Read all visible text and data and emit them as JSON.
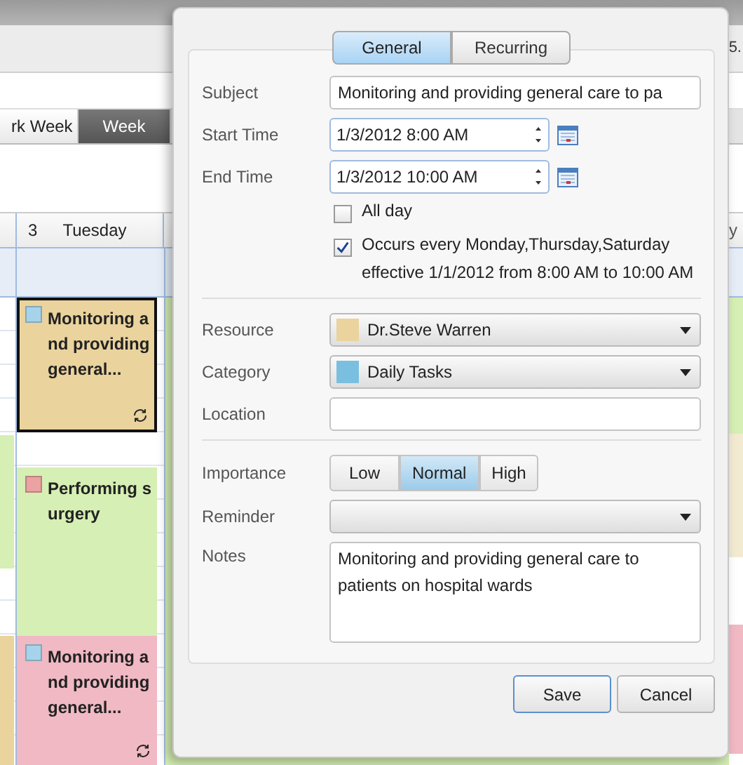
{
  "calendar": {
    "corner_text": "5.",
    "view_tabs": [
      {
        "label": "rk Week",
        "selected": false
      },
      {
        "label": "Week",
        "selected": true
      }
    ],
    "day_header": {
      "number": "3",
      "name": "Tuesday"
    },
    "right_header": "y",
    "appointments": [
      {
        "subject": "Monitoring and providing general...",
        "color": "#a6d3ea",
        "resource": {
          "color": "#ead39d"
        },
        "selected": true,
        "recurring": true
      },
      {
        "subject": "Performing surgery",
        "color": "#eaa2a2",
        "resource": {
          "color": "#d6efb4"
        },
        "selected": false,
        "recurring": false
      },
      {
        "subject": "Monitoring and providing general...",
        "color": "#a6d3ea",
        "resource": {
          "color": "#f0b9c4"
        },
        "selected": false,
        "recurring": true
      }
    ]
  },
  "dialog": {
    "tabs": [
      {
        "label": "General",
        "selected": true
      },
      {
        "label": "Recurring",
        "selected": false
      }
    ],
    "subject": {
      "label": "Subject",
      "value": "Monitoring and providing general care to pa"
    },
    "start_time": {
      "label": "Start Time",
      "value": "1/3/2012 8:00 AM"
    },
    "end_time": {
      "label": "End Time",
      "value": "1/3/2012 10:00 AM"
    },
    "all_day": {
      "label": "All day",
      "checked": false
    },
    "recurrence": {
      "checked": true,
      "text": "Occurs every Monday,Thursday,Saturday effective 1/1/2012 from 8:00 AM to 10:00 AM"
    },
    "resource": {
      "label": "Resource",
      "value": "Dr.Steve Warren",
      "color": "#ead39d"
    },
    "category": {
      "label": "Category",
      "value": "Daily Tasks",
      "color": "#7bbfe0"
    },
    "location": {
      "label": "Location"
    },
    "importance": {
      "label": "Importance",
      "options": [
        {
          "label": "Low",
          "selected": false
        },
        {
          "label": "Normal",
          "selected": true
        },
        {
          "label": "High",
          "selected": false
        }
      ]
    },
    "reminder": {
      "label": "Reminder"
    },
    "notes": {
      "label": "Notes",
      "value": "Monitoring and providing general care to patients on hospital wards"
    },
    "buttons": [
      {
        "label": "Save",
        "default": true
      },
      {
        "label": "Cancel",
        "default": false
      }
    ]
  }
}
